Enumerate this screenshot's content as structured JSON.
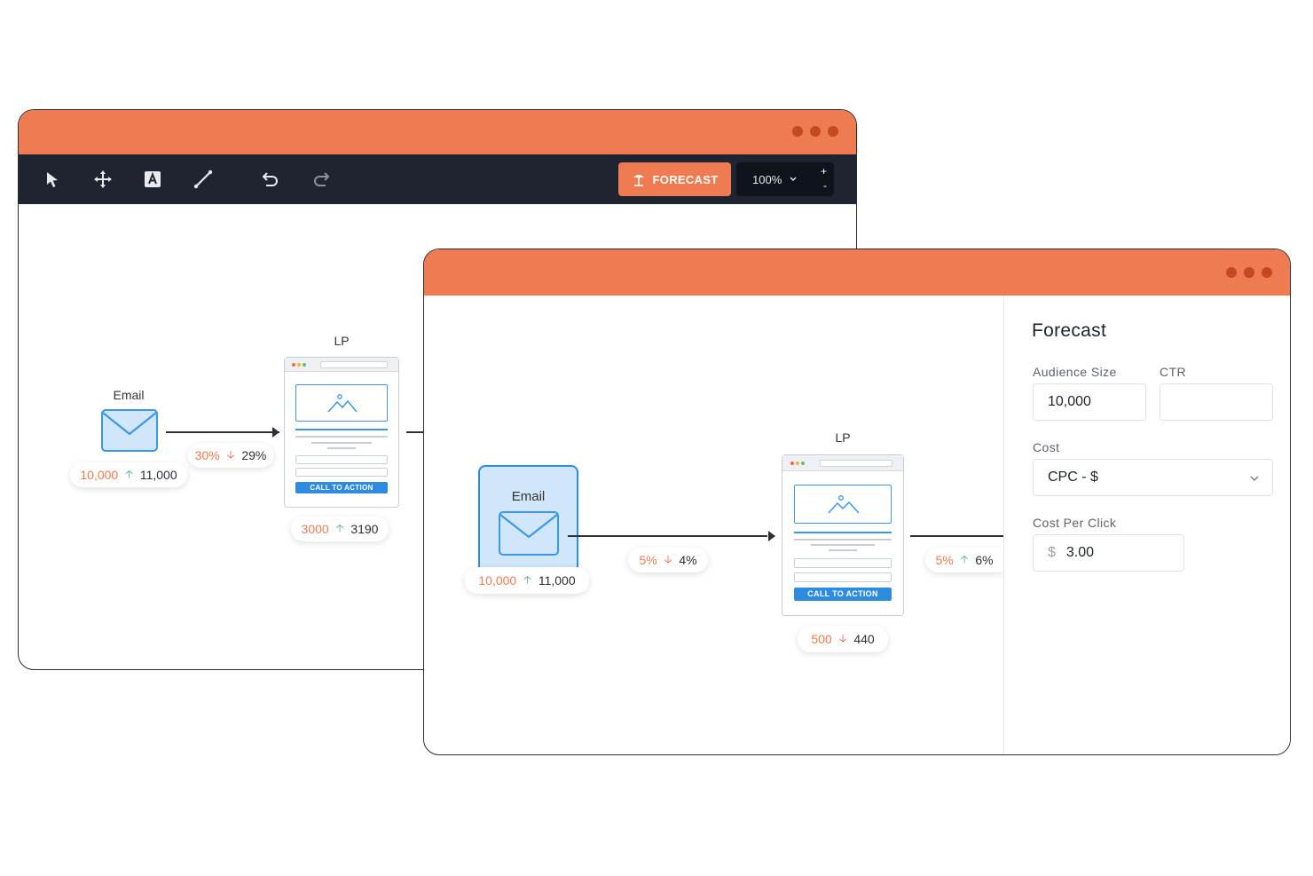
{
  "back_window": {
    "toolbar": {
      "tools": [
        "pointer-icon",
        "move-icon",
        "text-icon",
        "line-icon",
        "undo-icon",
        "redo-icon"
      ],
      "forecast_label": "FORECAST",
      "zoom_value": "100%",
      "zoom_plus": "+",
      "zoom_minus": "-"
    },
    "email": {
      "label": "Email",
      "from": "10,000",
      "to": "11,000",
      "trend": "up"
    },
    "edge1": {
      "from": "30%",
      "to": "29%",
      "trend": "down"
    },
    "lp": {
      "label": "LP",
      "cta": "CALL TO ACTION",
      "from": "3000",
      "to": "3190",
      "trend": "up"
    }
  },
  "front_window": {
    "email": {
      "label": "Email",
      "from": "10,000",
      "to": "11,000",
      "trend": "up"
    },
    "edge1": {
      "from": "5%",
      "to": "4%",
      "trend": "down"
    },
    "lp": {
      "label": "LP",
      "cta": "CALL TO ACTION",
      "from": "500",
      "to": "440",
      "trend": "down"
    },
    "edge2": {
      "from": "5%",
      "to": "6%",
      "trend": "up"
    },
    "forecast_panel": {
      "title": "Forecast",
      "audience_size_label": "Audience Size",
      "audience_size_value": "10,000",
      "ctr_label": "CTR",
      "ctr_value": "",
      "cost_label": "Cost",
      "cost_value": "CPC - $",
      "cost_per_click_label": "Cost Per Click",
      "currency_symbol": "$",
      "cost_per_click_value": "3.00"
    }
  },
  "colors": {
    "accent": "#ee7b52",
    "toolbar": "#1f2430",
    "cta": "#2d8be0",
    "up": "#3cb371",
    "down": "#e2583e"
  }
}
